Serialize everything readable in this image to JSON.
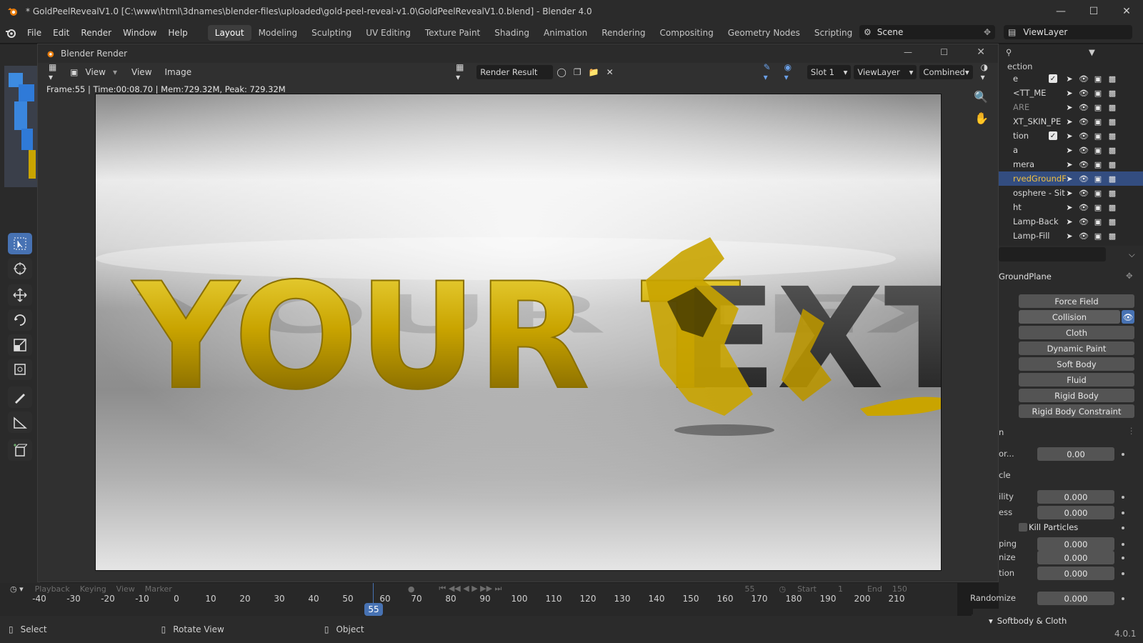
{
  "window": {
    "title": "* GoldPeelRevealV1.0 [C:\\www\\html\\3dnames\\blender-files\\uploaded\\gold-peel-reveal-v1.0\\GoldPeelRevealV1.0.blend] - Blender 4.0"
  },
  "menu": [
    "File",
    "Edit",
    "Render",
    "Window",
    "Help"
  ],
  "workspaces": [
    "Layout",
    "Modeling",
    "Sculpting",
    "UV Editing",
    "Texture Paint",
    "Shading",
    "Animation",
    "Rendering",
    "Compositing",
    "Geometry Nodes",
    "Scripting"
  ],
  "active_workspace": "Layout",
  "scene_name": "Scene",
  "viewlayer_name": "ViewLayer",
  "render_window": {
    "title": "Blender Render",
    "menu_view1": "View",
    "menu_view2": "View",
    "menu_image": "Image",
    "image_name": "Render Result",
    "slot": "Slot 1",
    "viewlayer": "ViewLayer",
    "pass": "Combined",
    "stats": "Frame:55 | Time:00:08.70 | Mem:729.32M, Peak: 729.32M",
    "render_text_gold": "YOUR T",
    "render_text_dark": "EXT"
  },
  "outliner": {
    "header": "ection",
    "rows": [
      {
        "label": "e",
        "checkbox": true
      },
      {
        "label": "<TT_ME"
      },
      {
        "label": "ARE",
        "dim": true
      },
      {
        "label": "XT_SKIN_PE"
      },
      {
        "label": "tion",
        "checkbox": true
      },
      {
        "label": "a"
      },
      {
        "label": "mera"
      },
      {
        "label": "rvedGroundF",
        "selected": true
      },
      {
        "label": "osphere - Sit"
      },
      {
        "label": "ht"
      },
      {
        "label": "Lamp-Back"
      },
      {
        "label": "Lamp-Fill"
      }
    ]
  },
  "properties": {
    "object_name": "GroundPlane",
    "physics_buttons": [
      "Force Field",
      "Collision",
      "Cloth",
      "Dynamic Paint",
      "Soft Body",
      "Fluid",
      "Rigid Body",
      "Rigid Body Constraint"
    ],
    "section_label1": "n",
    "row1": {
      "label": "or...",
      "value": "0.00"
    },
    "section_label2": "cle",
    "fields": [
      {
        "label": "ility",
        "value": "0.000"
      },
      {
        "label": "ess",
        "value": "0.000"
      }
    ],
    "kill_particles": "Kill Particles",
    "fields2": [
      {
        "label": "ping",
        "value": "0.000"
      },
      {
        "label": "nize",
        "value": "0.000"
      },
      {
        "label": "tion",
        "value": "0.000"
      },
      {
        "label": "Randomize",
        "value": "0.000"
      }
    ],
    "softbody_section": "Softbody & Cloth",
    "version": "4.0.1"
  },
  "timeline": {
    "menus": [
      "Playback",
      "Keying",
      "View",
      "Marker"
    ],
    "current_frame": "55",
    "current_frame_field": "55",
    "start_label": "Start",
    "start_value": "1",
    "end_label": "End",
    "end_value": "150",
    "ticks": [
      "-40",
      "-30",
      "-20",
      "-10",
      "0",
      "10",
      "20",
      "30",
      "40",
      "50",
      "60",
      "70",
      "80",
      "90",
      "100",
      "110",
      "120",
      "130",
      "140",
      "150",
      "160",
      "170",
      "180",
      "190",
      "200",
      "210"
    ]
  },
  "statusbar": {
    "select": "Select",
    "rotate": "Rotate View",
    "object": "Object"
  },
  "colors": {
    "accent": "#4772b3",
    "selection": "#334d80",
    "gold": "#c9a400"
  }
}
